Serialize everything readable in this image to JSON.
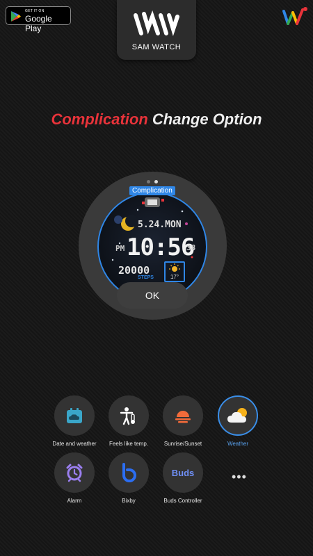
{
  "badge": {
    "small": "GET IT ON",
    "big": "Google Play"
  },
  "brand": {
    "name": "SAM WATCH"
  },
  "headline": {
    "red": "Complication",
    "white": "Change Option"
  },
  "preview": {
    "complication_label": "Complication",
    "date": "5.24.MON",
    "ampm": "PM",
    "time": "10:56",
    "seconds": "38",
    "steps": "20000",
    "steps_label": "STEPS",
    "temp": "17°",
    "ok_label": "OK",
    "page_count": 2,
    "active_page": 2
  },
  "options": [
    {
      "label": "Date and weather",
      "icon": "calendar-cloud-icon"
    },
    {
      "label": "Feels like temp.",
      "icon": "person-thermometer-icon"
    },
    {
      "label": "Sunrise/Sunset",
      "icon": "sunset-icon"
    },
    {
      "label": "Weather",
      "icon": "weather-cloud-sun-icon",
      "selected": true
    },
    {
      "label": "Alarm",
      "icon": "alarm-clock-icon"
    },
    {
      "label": "Bixby",
      "icon": "bixby-icon"
    },
    {
      "label": "Buds Controller",
      "icon": "buds-icon",
      "icon_text": "Buds"
    }
  ],
  "more_label": "•••",
  "colors": {
    "accent": "#2f86e6",
    "headline_red": "#e8333a"
  }
}
